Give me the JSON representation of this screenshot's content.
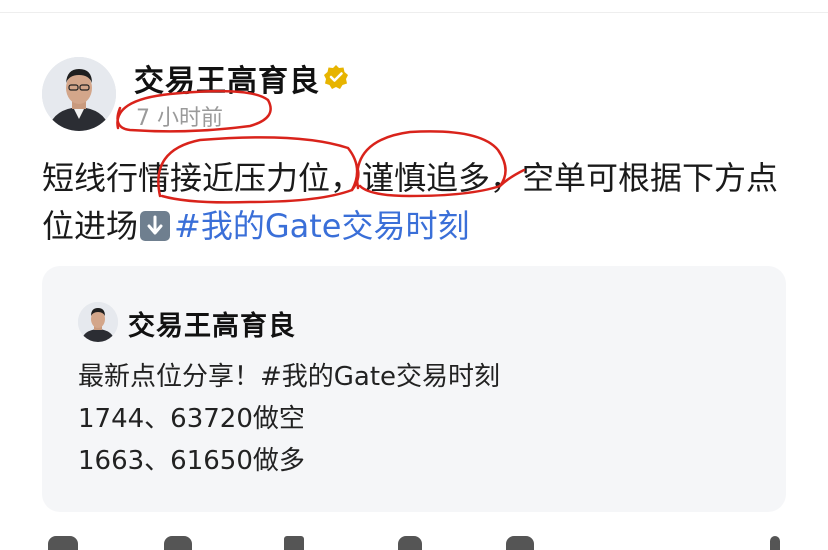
{
  "post": {
    "author": "交易王高育良",
    "time": "7 小时前",
    "text_part1": "短线行情接近压力位，谨慎追多，空单可根据下方点位进场",
    "hashtag": "#我的Gate交易时刻"
  },
  "quote": {
    "author": "交易王高育良",
    "line1": "最新点位分享！#我的Gate交易时刻",
    "line2": "1744、63720做空",
    "line3": "1663、61650做多"
  },
  "colors": {
    "hashtag": "#3a6fd8",
    "verified_badge": "#e7b400",
    "annotation": "#d9231b"
  },
  "icons": [
    "verified-badge-icon",
    "down-arrow-emoji-icon",
    "like-icon",
    "comment-icon",
    "bookmark-icon",
    "share-icon",
    "views-icon",
    "more-icon"
  ]
}
